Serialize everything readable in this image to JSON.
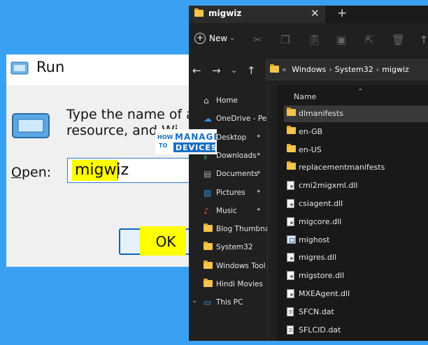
{
  "run_dialog": {
    "title": "Run",
    "description": "Type the name of a pr\nresource, and Wi",
    "open_label_accel": "O",
    "open_label_rest": "pen:",
    "input_value": "migwiz",
    "ok_label": "OK",
    "highlight_color": "#ffff00"
  },
  "logo": {
    "line1": "HOW",
    "line2": "TO",
    "word1": "MANAGE",
    "word2": "DEVICES"
  },
  "explorer": {
    "tab_title": "migwiz",
    "new_tab": "+",
    "close_tab": "✕",
    "toolbar": {
      "new_label": "New"
    },
    "address": [
      "«",
      "Windows",
      "System32",
      "migwiz"
    ],
    "sidebar": [
      {
        "label": "Home",
        "icon": "home-icon",
        "pinned": false
      },
      {
        "label": "OneDrive - Per",
        "icon": "onedrive-icon",
        "pinned": false
      },
      {
        "label": "Desktop",
        "icon": "desktop-icon",
        "pinned": true
      },
      {
        "label": "Downloads",
        "icon": "download-icon",
        "pinned": true
      },
      {
        "label": "Documents",
        "icon": "documents-icon",
        "pinned": true
      },
      {
        "label": "Pictures",
        "icon": "pictures-icon",
        "pinned": true
      },
      {
        "label": "Music",
        "icon": "music-icon",
        "pinned": true
      },
      {
        "label": "Blog Thumbna",
        "icon": "folder-icon",
        "pinned": false
      },
      {
        "label": "System32",
        "icon": "folder-icon",
        "pinned": false
      },
      {
        "label": "Windows Tool",
        "icon": "folder-icon",
        "pinned": false
      },
      {
        "label": "Hindi Movies",
        "icon": "folder-icon",
        "pinned": false
      },
      {
        "label": "This PC",
        "icon": "pc-icon",
        "pinned": false
      }
    ],
    "column_header": "Name",
    "files": [
      {
        "name": "dlmanifests",
        "type": "folder",
        "selected": true
      },
      {
        "name": "en-GB",
        "type": "folder",
        "selected": false
      },
      {
        "name": "en-US",
        "type": "folder",
        "selected": false
      },
      {
        "name": "replacementmanifests",
        "type": "folder",
        "selected": false
      },
      {
        "name": "cmi2migxml.dll",
        "type": "dll",
        "selected": false
      },
      {
        "name": "csiagent.dll",
        "type": "dll",
        "selected": false
      },
      {
        "name": "migcore.dll",
        "type": "dll",
        "selected": false
      },
      {
        "name": "mighost",
        "type": "exe",
        "selected": false
      },
      {
        "name": "migres.dll",
        "type": "dll",
        "selected": false
      },
      {
        "name": "migstore.dll",
        "type": "dll",
        "selected": false
      },
      {
        "name": "MXEAgent.dll",
        "type": "dll",
        "selected": false
      },
      {
        "name": "SFCN.dat",
        "type": "dat",
        "selected": false
      },
      {
        "name": "SFLCID.dat",
        "type": "dat",
        "selected": false
      }
    ]
  }
}
